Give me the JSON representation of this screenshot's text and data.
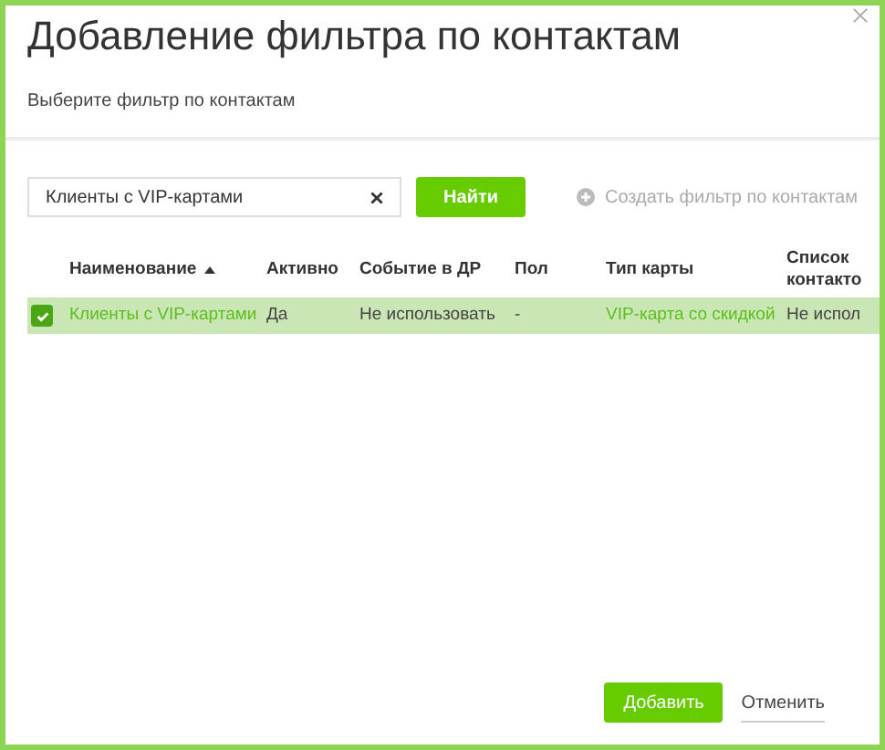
{
  "dialog": {
    "title": "Добавление фильтра по контактам",
    "subtitle": "Выберите фильтр по контактам"
  },
  "search": {
    "value": "Клиенты с VIP-картами",
    "button": "Найти"
  },
  "create_link": "Создать фильтр по контактам",
  "table": {
    "columns": [
      {
        "label": "Наименование",
        "sorted": true
      },
      {
        "label": "Активно",
        "sorted": false
      },
      {
        "label": "Событие в ДР",
        "sorted": false
      },
      {
        "label": "Пол",
        "sorted": false
      },
      {
        "label": "Тип карты",
        "sorted": false
      },
      {
        "label": "Список контакто",
        "sorted": false
      }
    ],
    "rows": [
      {
        "selected": true,
        "checked": true,
        "cells": [
          {
            "text": "Клиенты с VIP-картами",
            "kind": "link"
          },
          {
            "text": "Да",
            "kind": "text"
          },
          {
            "text": "Не использовать",
            "kind": "text"
          },
          {
            "text": "-",
            "kind": "text"
          },
          {
            "text": "VIP-карта со скидкой",
            "kind": "link"
          },
          {
            "text": "Не испол",
            "kind": "text"
          }
        ]
      }
    ]
  },
  "footer": {
    "add": "Добавить",
    "cancel": "Отменить"
  }
}
